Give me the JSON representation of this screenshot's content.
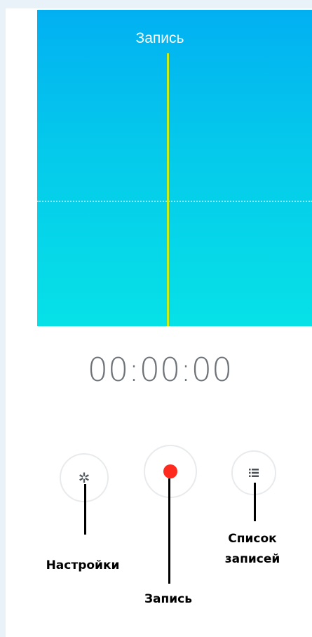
{
  "recorder": {
    "title": "Запись",
    "timer": "00:00:00"
  },
  "controls": {
    "settings_icon": "gear-icon",
    "record_icon": "record-dot-icon",
    "list_icon": "list-icon",
    "record_color": "#ff2a1e",
    "wave_gradient_top": "#02b0f2",
    "wave_gradient_bottom": "#06e1e7",
    "playhead_color": "#c9ee1a"
  },
  "annotations": {
    "settings": "Настройки",
    "record": "Запись",
    "list_line1": "Список",
    "list_line2": "записей"
  }
}
